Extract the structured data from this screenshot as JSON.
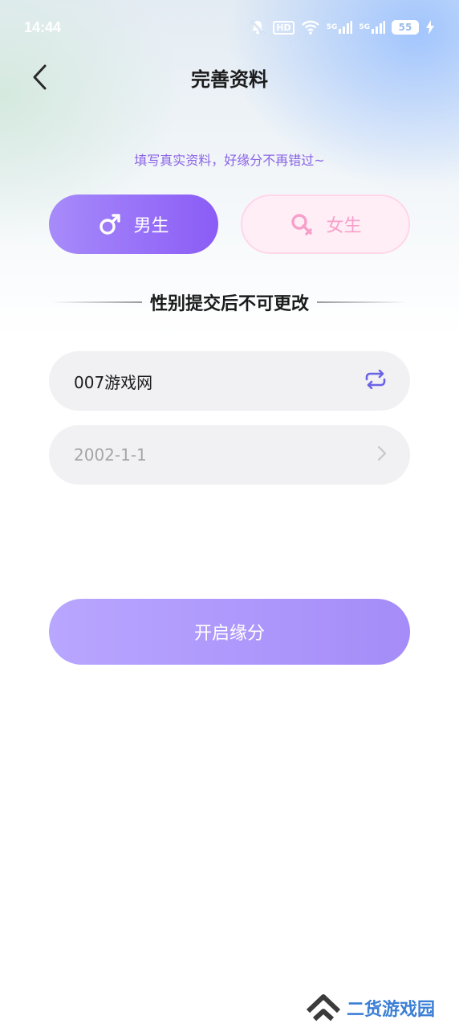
{
  "status_bar": {
    "time": "14:44",
    "icons": [
      "bell-off-icon",
      "hd-icon",
      "wifi-icon",
      "signal-5g-icon",
      "signal-5g-icon",
      "battery-icon",
      "charging-icon"
    ],
    "hd_label": "HD",
    "network_1": "5G",
    "network_2": "5G",
    "battery_level": "55"
  },
  "header": {
    "title": "完善资料",
    "back_icon": "chevron-left-icon"
  },
  "subtitle": "填写真实资料，好缘分不再错过~",
  "gender": {
    "male_label": "男生",
    "female_label": "女生",
    "male_icon": "male-symbol-icon",
    "female_icon": "female-symbol-icon",
    "selected": "male",
    "colors": {
      "male_start": "#a78bfa",
      "male_end": "#8b5cf6",
      "female_bg": "#ffeef6",
      "female_text": "#f7a0c9"
    }
  },
  "notice": "性别提交后不可更改",
  "form": {
    "nickname_value": "007游戏网",
    "nickname_action_icon": "refresh-icon",
    "birthday_value": "2002-1-1",
    "birthday_action_icon": "chevron-right-icon"
  },
  "submit_label": "开启缘分",
  "watermark": {
    "text": "二货游戏园",
    "logo_icon": "double-chevron-up-icon"
  },
  "accent_color": "#8a63e6"
}
